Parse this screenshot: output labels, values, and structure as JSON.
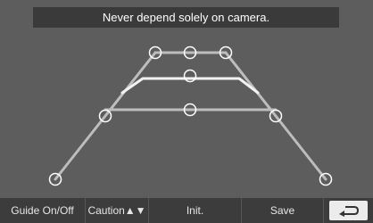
{
  "warning": {
    "text": "Never depend solely on camera."
  },
  "buttons": {
    "guide": "Guide On/Off",
    "caution": "Caution▲▼",
    "init": "Init.",
    "save": "Save"
  },
  "icons": {
    "back": "return-arrow-icon",
    "handle": "circle-handle-icon"
  },
  "colors": {
    "background": "#5d5d5d",
    "bar": "#3a3a3a",
    "guide_line_bright": "#f2f2f2",
    "guide_line_dim": "#bdbdbd"
  }
}
